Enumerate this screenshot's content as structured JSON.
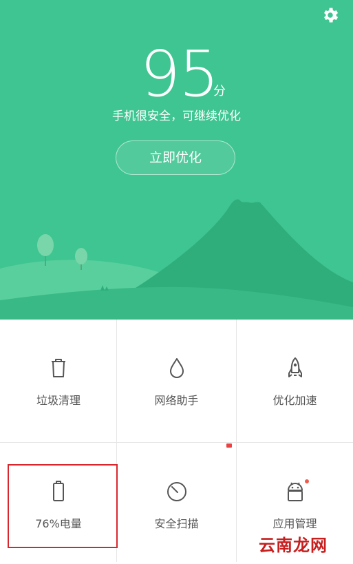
{
  "header": {
    "score": "95",
    "score_unit": "分",
    "status_text": "手机很安全，可继续优化",
    "optimize_button": "立即优化"
  },
  "tiles": [
    {
      "label": "垃圾清理",
      "icon": "trash-icon"
    },
    {
      "label": "网络助手",
      "icon": "droplet-icon"
    },
    {
      "label": "优化加速",
      "icon": "rocket-icon"
    },
    {
      "label": "76%电量",
      "icon": "battery-icon"
    },
    {
      "label": "安全扫描",
      "icon": "scan-icon"
    },
    {
      "label": "应用管理",
      "icon": "android-icon"
    }
  ],
  "watermark": "云南龙网",
  "colors": {
    "hero_bg": "#3fc591",
    "highlight_border": "#d9262c",
    "label_text": "#555555"
  }
}
